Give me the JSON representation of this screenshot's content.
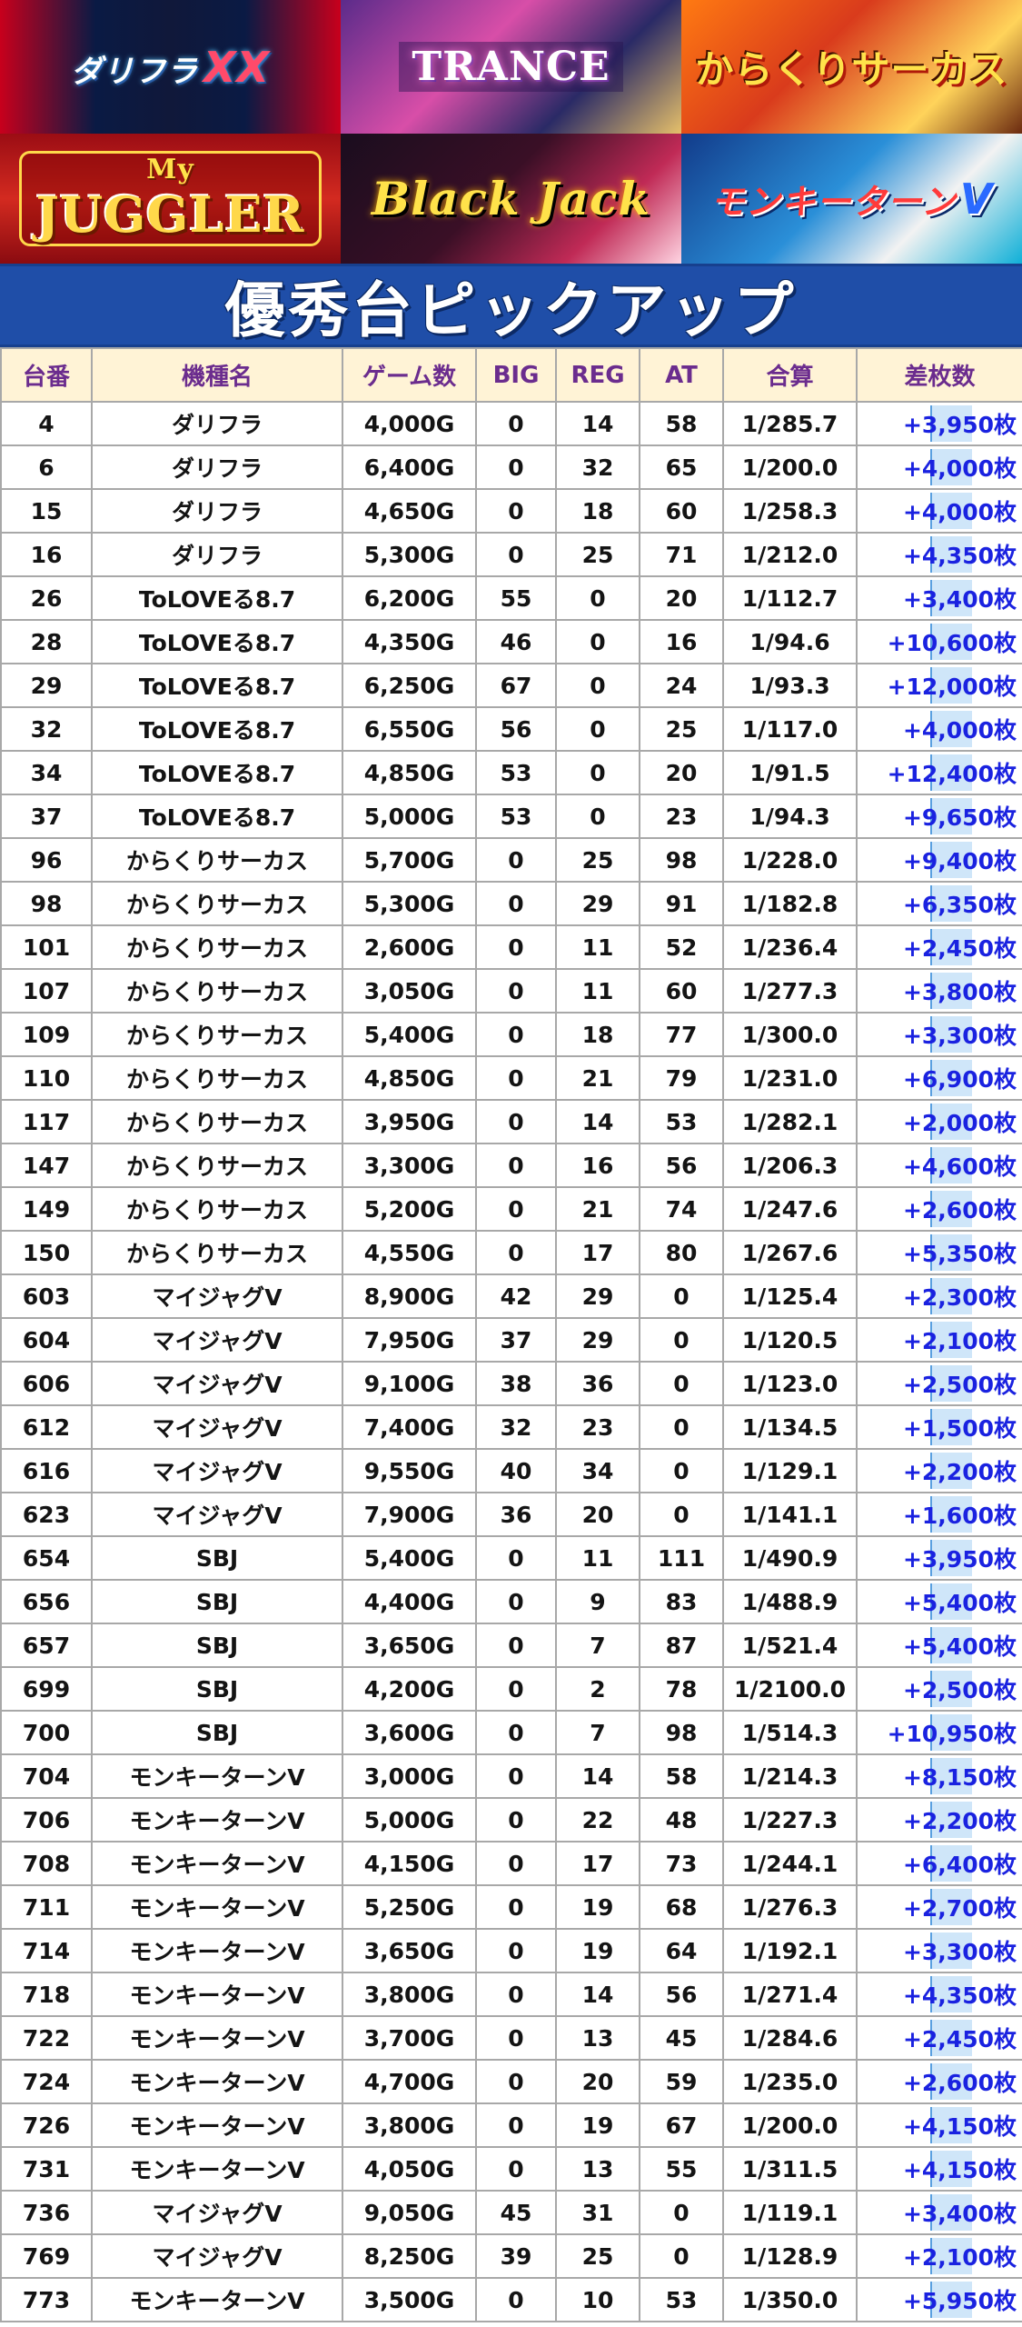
{
  "banners": [
    {
      "text": "ダリフラ",
      "accent": "XX"
    },
    {
      "text": "TRANCE"
    },
    {
      "text": "からくりサーカス"
    },
    {
      "text": "JUGGLER",
      "sub": "My"
    },
    {
      "text": "Black Jack"
    },
    {
      "text": "モンキーターン",
      "accent": "V"
    }
  ],
  "title": "優秀台ピックアップ",
  "columns": [
    "台番",
    "機種名",
    "ゲーム数",
    "BIG",
    "REG",
    "AT",
    "合算",
    "差枚数"
  ],
  "rows": [
    [
      "4",
      "ダリフラ",
      "4,000G",
      "0",
      "14",
      "58",
      "1/285.7",
      "+3,950枚"
    ],
    [
      "6",
      "ダリフラ",
      "6,400G",
      "0",
      "32",
      "65",
      "1/200.0",
      "+4,000枚"
    ],
    [
      "15",
      "ダリフラ",
      "4,650G",
      "0",
      "18",
      "60",
      "1/258.3",
      "+4,000枚"
    ],
    [
      "16",
      "ダリフラ",
      "5,300G",
      "0",
      "25",
      "71",
      "1/212.0",
      "+4,350枚"
    ],
    [
      "26",
      "ToLOVEる8.7",
      "6,200G",
      "55",
      "0",
      "20",
      "1/112.7",
      "+3,400枚"
    ],
    [
      "28",
      "ToLOVEる8.7",
      "4,350G",
      "46",
      "0",
      "16",
      "1/94.6",
      "+10,600枚"
    ],
    [
      "29",
      "ToLOVEる8.7",
      "6,250G",
      "67",
      "0",
      "24",
      "1/93.3",
      "+12,000枚"
    ],
    [
      "32",
      "ToLOVEる8.7",
      "6,550G",
      "56",
      "0",
      "25",
      "1/117.0",
      "+4,000枚"
    ],
    [
      "34",
      "ToLOVEる8.7",
      "4,850G",
      "53",
      "0",
      "20",
      "1/91.5",
      "+12,400枚"
    ],
    [
      "37",
      "ToLOVEる8.7",
      "5,000G",
      "53",
      "0",
      "23",
      "1/94.3",
      "+9,650枚"
    ],
    [
      "96",
      "からくりサーカス",
      "5,700G",
      "0",
      "25",
      "98",
      "1/228.0",
      "+9,400枚"
    ],
    [
      "98",
      "からくりサーカス",
      "5,300G",
      "0",
      "29",
      "91",
      "1/182.8",
      "+6,350枚"
    ],
    [
      "101",
      "からくりサーカス",
      "2,600G",
      "0",
      "11",
      "52",
      "1/236.4",
      "+2,450枚"
    ],
    [
      "107",
      "からくりサーカス",
      "3,050G",
      "0",
      "11",
      "60",
      "1/277.3",
      "+3,800枚"
    ],
    [
      "109",
      "からくりサーカス",
      "5,400G",
      "0",
      "18",
      "77",
      "1/300.0",
      "+3,300枚"
    ],
    [
      "110",
      "からくりサーカス",
      "4,850G",
      "0",
      "21",
      "79",
      "1/231.0",
      "+6,900枚"
    ],
    [
      "117",
      "からくりサーカス",
      "3,950G",
      "0",
      "14",
      "53",
      "1/282.1",
      "+2,000枚"
    ],
    [
      "147",
      "からくりサーカス",
      "3,300G",
      "0",
      "16",
      "56",
      "1/206.3",
      "+4,600枚"
    ],
    [
      "149",
      "からくりサーカス",
      "5,200G",
      "0",
      "21",
      "74",
      "1/247.6",
      "+2,600枚"
    ],
    [
      "150",
      "からくりサーカス",
      "4,550G",
      "0",
      "17",
      "80",
      "1/267.6",
      "+5,350枚"
    ],
    [
      "603",
      "マイジャグV",
      "8,900G",
      "42",
      "29",
      "0",
      "1/125.4",
      "+2,300枚"
    ],
    [
      "604",
      "マイジャグV",
      "7,950G",
      "37",
      "29",
      "0",
      "1/120.5",
      "+2,100枚"
    ],
    [
      "606",
      "マイジャグV",
      "9,100G",
      "38",
      "36",
      "0",
      "1/123.0",
      "+2,500枚"
    ],
    [
      "612",
      "マイジャグV",
      "7,400G",
      "32",
      "23",
      "0",
      "1/134.5",
      "+1,500枚"
    ],
    [
      "616",
      "マイジャグV",
      "9,550G",
      "40",
      "34",
      "0",
      "1/129.1",
      "+2,200枚"
    ],
    [
      "623",
      "マイジャグV",
      "7,900G",
      "36",
      "20",
      "0",
      "1/141.1",
      "+1,600枚"
    ],
    [
      "654",
      "SBJ",
      "5,400G",
      "0",
      "11",
      "111",
      "1/490.9",
      "+3,950枚"
    ],
    [
      "656",
      "SBJ",
      "4,400G",
      "0",
      "9",
      "83",
      "1/488.9",
      "+5,400枚"
    ],
    [
      "657",
      "SBJ",
      "3,650G",
      "0",
      "7",
      "87",
      "1/521.4",
      "+5,400枚"
    ],
    [
      "699",
      "SBJ",
      "4,200G",
      "0",
      "2",
      "78",
      "1/2100.0",
      "+2,500枚"
    ],
    [
      "700",
      "SBJ",
      "3,600G",
      "0",
      "7",
      "98",
      "1/514.3",
      "+10,950枚"
    ],
    [
      "704",
      "モンキーターンV",
      "3,000G",
      "0",
      "14",
      "58",
      "1/214.3",
      "+8,150枚"
    ],
    [
      "706",
      "モンキーターンV",
      "5,000G",
      "0",
      "22",
      "48",
      "1/227.3",
      "+2,200枚"
    ],
    [
      "708",
      "モンキーターンV",
      "4,150G",
      "0",
      "17",
      "73",
      "1/244.1",
      "+6,400枚"
    ],
    [
      "711",
      "モンキーターンV",
      "5,250G",
      "0",
      "19",
      "68",
      "1/276.3",
      "+2,700枚"
    ],
    [
      "714",
      "モンキーターンV",
      "3,650G",
      "0",
      "19",
      "64",
      "1/192.1",
      "+3,300枚"
    ],
    [
      "718",
      "モンキーターンV",
      "3,800G",
      "0",
      "14",
      "56",
      "1/271.4",
      "+4,350枚"
    ],
    [
      "722",
      "モンキーターンV",
      "3,700G",
      "0",
      "13",
      "45",
      "1/284.6",
      "+2,450枚"
    ],
    [
      "724",
      "モンキーターンV",
      "4,700G",
      "0",
      "20",
      "59",
      "1/235.0",
      "+2,600枚"
    ],
    [
      "726",
      "モンキーターンV",
      "3,800G",
      "0",
      "19",
      "67",
      "1/200.0",
      "+4,150枚"
    ],
    [
      "731",
      "モンキーターンV",
      "4,050G",
      "0",
      "13",
      "55",
      "1/311.5",
      "+4,150枚"
    ],
    [
      "736",
      "マイジャグV",
      "9,050G",
      "45",
      "31",
      "0",
      "1/119.1",
      "+3,400枚"
    ],
    [
      "769",
      "マイジャグV",
      "8,250G",
      "39",
      "25",
      "0",
      "1/128.9",
      "+2,100枚"
    ],
    [
      "773",
      "モンキーターンV",
      "3,500G",
      "0",
      "10",
      "53",
      "1/350.0",
      "+5,950枚"
    ]
  ],
  "colors": {
    "title_bg": "#1f4ea8",
    "header_bg": "#fff3d6",
    "header_text": "#6b2c8e",
    "diff_text": "#1a22e0",
    "bar_fill": "#cfe6f9"
  }
}
